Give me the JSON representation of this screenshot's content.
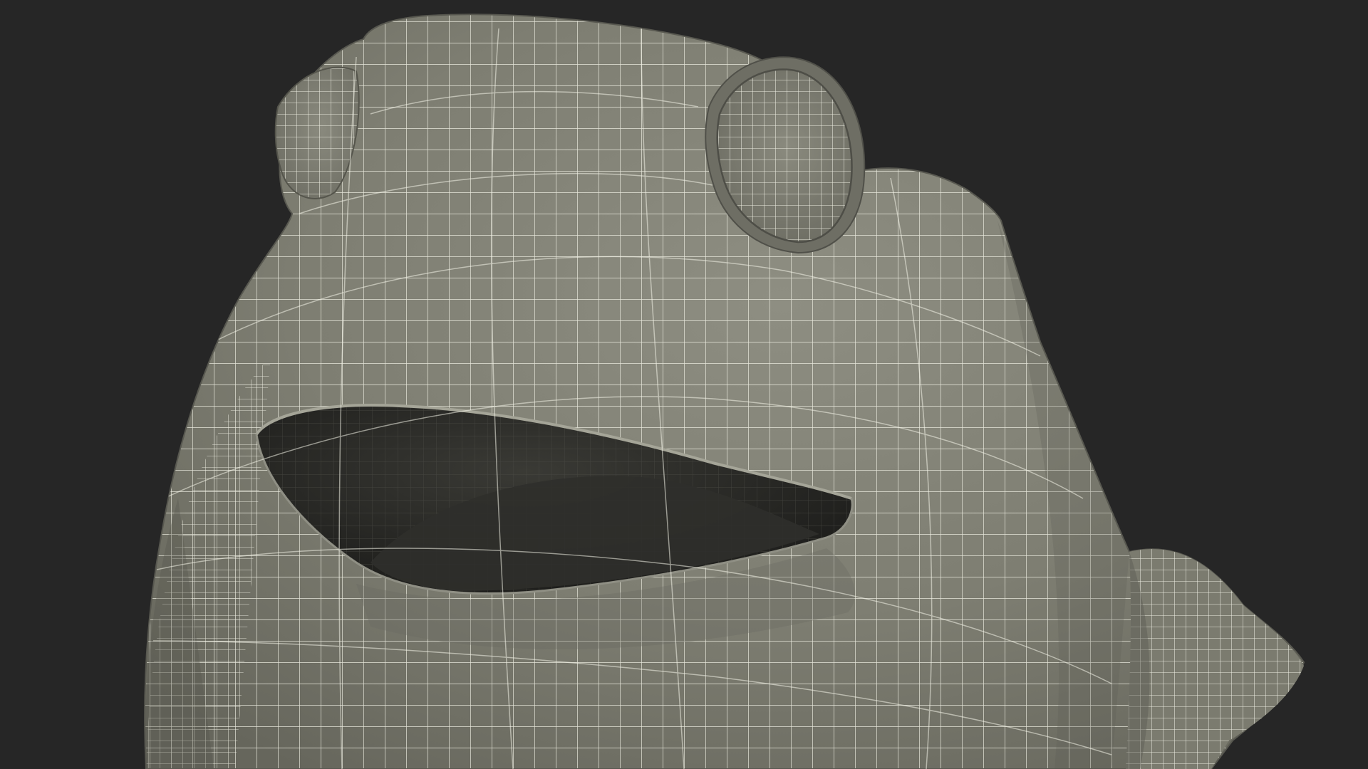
{
  "scene": {
    "subject": "frog-head-wireframe-render",
    "colors": {
      "background": "#262626",
      "surface": "#7d7d71",
      "surface_light": "#8d8d81",
      "surface_shadow": "#5f5f55",
      "wire": "#f0f0e4",
      "mouth_interior": "#2b2b28",
      "mouth_deep": "#1b1b19"
    }
  }
}
